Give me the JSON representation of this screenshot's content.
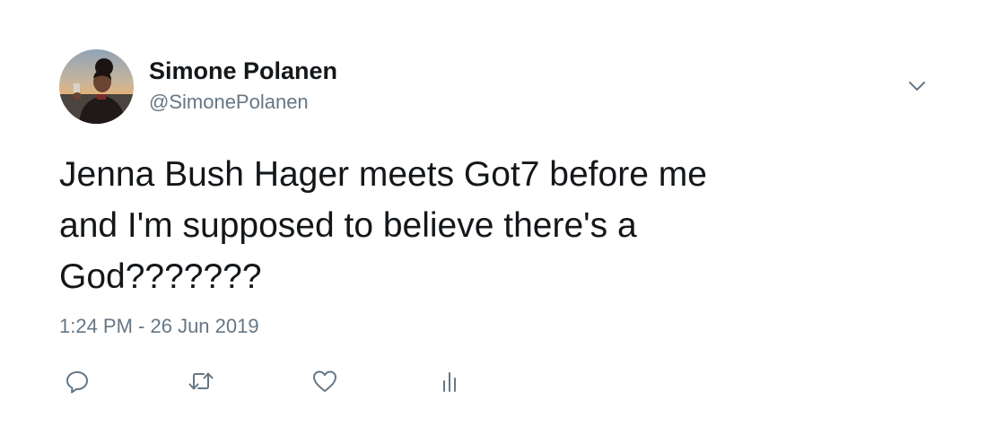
{
  "tweet": {
    "author": {
      "display_name": "Simone Polanen",
      "handle": "@SimonePolanen"
    },
    "text": "Jenna Bush Hager meets Got7 before me\nand I'm supposed to believe there's a\nGod???????",
    "timestamp": "1:24 PM - 26 Jun 2019"
  },
  "icons": {
    "caret": "chevron-down-icon",
    "reply": "reply-icon",
    "retweet": "retweet-icon",
    "like": "heart-icon",
    "analytics": "analytics-icon"
  },
  "colors": {
    "text_primary": "#14171a",
    "text_secondary": "#657786",
    "icon": "#657786",
    "background": "#ffffff"
  }
}
